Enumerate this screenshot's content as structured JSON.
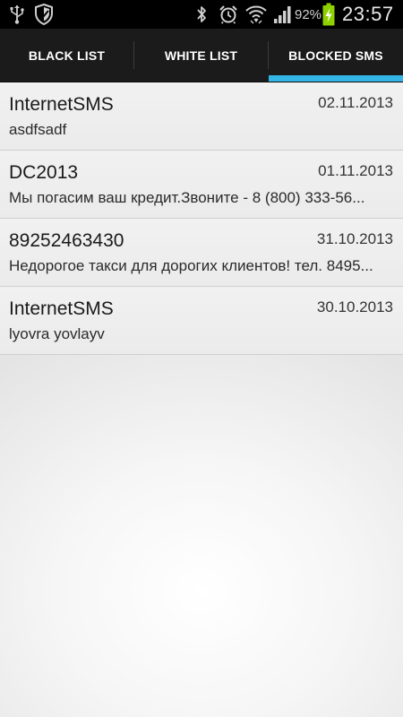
{
  "status_bar": {
    "battery_percent": "92%",
    "time": "23:57",
    "icons": [
      "usb-icon",
      "shield-icon",
      "bluetooth-icon",
      "alarm-icon",
      "wifi-icon",
      "signal-icon",
      "battery-charging-icon"
    ]
  },
  "tabs": [
    {
      "label": "BLACK LIST",
      "selected": false
    },
    {
      "label": "WHITE LIST",
      "selected": false
    },
    {
      "label": "BLOCKED SMS",
      "selected": true
    }
  ],
  "colors": {
    "accent": "#33b5e5",
    "battery_charging": "#8fd100"
  },
  "messages": [
    {
      "sender": "InternetSMS",
      "date": "02.11.2013",
      "body": "asdfsadf"
    },
    {
      "sender": "DC2013",
      "date": "01.11.2013",
      "body": "Мы погасим ваш кредит.Звоните - 8 (800) 333-56..."
    },
    {
      "sender": "89252463430",
      "date": "31.10.2013",
      "body": "Недорогое такси для дорогих клиентов! тел. 8495..."
    },
    {
      "sender": "InternetSMS",
      "date": "30.10.2013",
      "body": "lyovra yovlayv"
    }
  ]
}
